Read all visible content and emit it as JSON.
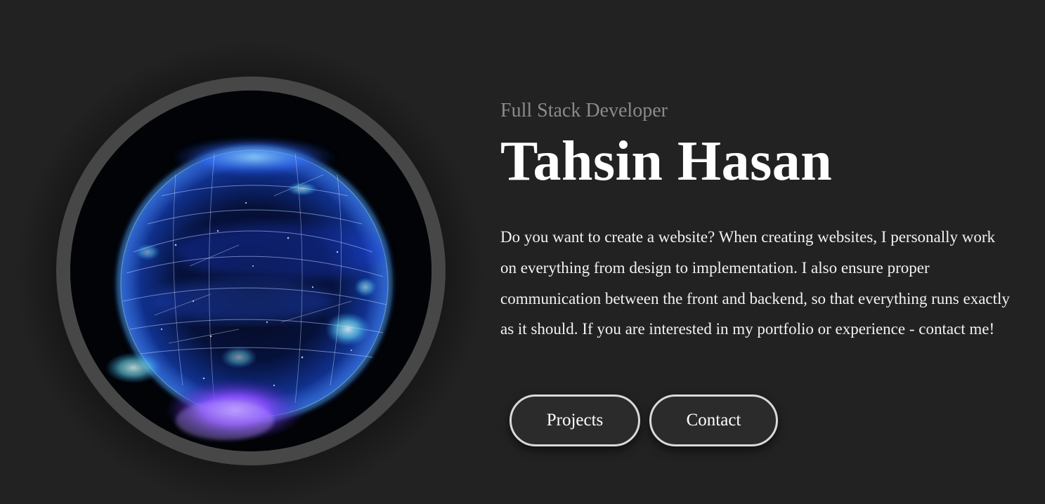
{
  "hero": {
    "subtitle": "Full Stack Developer",
    "name": "Tahsin Hasan",
    "intro": "Do you want to create a website? When creating websites, I personally work on everything from design to implementation. I also ensure proper communication between the front and backend, so that everything runs exactly as it should. If you are interested in my portfolio or experience - contact me!"
  },
  "buttons": {
    "projects_label": "Projects",
    "contact_label": "Contact"
  },
  "colors": {
    "background": "#222222",
    "ring": "#474747",
    "subtitle": "#8b8b8b",
    "text": "#ffffff",
    "button_border": "#d9d9d9",
    "button_fill": "#2b2b2b",
    "globe_blue": "#2a5cff",
    "globe_cyan": "#6fe7ff",
    "globe_purple": "#8a4cff"
  },
  "image": {
    "subject": "glowing particle globe"
  }
}
